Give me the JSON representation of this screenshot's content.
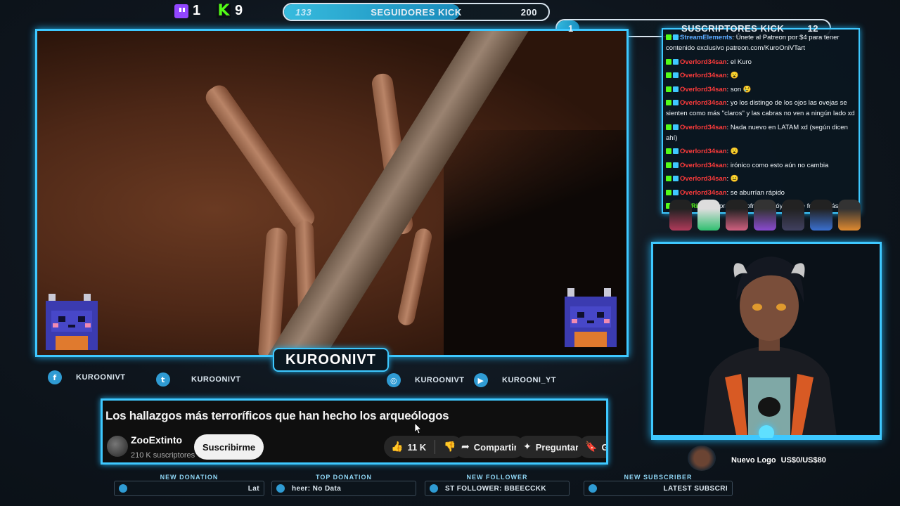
{
  "top_bar": {
    "twitch_count": "1",
    "kick_count": "9",
    "followers_goal": {
      "current": "133",
      "label": "SEGUIDORES KICK",
      "target": "200",
      "progress": 0.665
    },
    "subscribers_goal": {
      "current": "1",
      "label": "SUSCRIPTORES KICK",
      "target": "12",
      "progress": 0.083
    }
  },
  "brand_tag": "KUROONIVT",
  "socials": {
    "facebook": "KUROONIVT",
    "twitter": "KUROONIVT",
    "instagram": "KUROONIVT",
    "youtube": "KUROONI_YT"
  },
  "youtube": {
    "title": "Los hallazgos más terroríficos que han hecho los arqueólogos",
    "channel": "ZooExtinto",
    "subscribers": "210 K suscriptores",
    "subscribe_label": "Suscribirme",
    "likes": "11 K",
    "share_label": "Compartir",
    "ask_label": "Preguntar",
    "save_label": "Gu"
  },
  "alerts": [
    {
      "label": "NEW DONATION",
      "value": "Lat"
    },
    {
      "label": "TOP DONATION",
      "value": "heer: No Data"
    },
    {
      "label": "NEW FOLLOWER",
      "value": "ST FOLLOWER: BBEECCKK"
    },
    {
      "label": "NEW SUBSCRIBER",
      "value": "LATEST SUBSCRI"
    }
  ],
  "chat": [
    {
      "user": "StreamElements",
      "color": "#5aa9ff",
      "text": ": Únete al Patreon por $4 para tener contenido exclusivo patreon.com/KuroOniVTart"
    },
    {
      "user": "Overlord34san",
      "color": "#ff3b3b",
      "text": ": el Kuro"
    },
    {
      "user": "Overlord34san",
      "color": "#ff3b3b",
      "text": ": 😮"
    },
    {
      "user": "Overlord34san",
      "color": "#ff3b3b",
      "text": ": son 😢"
    },
    {
      "user": "Overlord34san",
      "color": "#ff3b3b",
      "text": ": yo los distingo de los ojos las ovejas se sienten como más \"claros\" y las cabras no ven a ningún lado xd"
    },
    {
      "user": "Overlord34san",
      "color": "#ff3b3b",
      "text": ": Nada nuevo en LATAM xd (según dicen ahí)"
    },
    {
      "user": "Overlord34san",
      "color": "#ff3b3b",
      "text": ": 😮"
    },
    {
      "user": "Overlord34san",
      "color": "#ff3b3b",
      "text": ": irónico como esto aún no cambia"
    },
    {
      "user": "Overlord34san",
      "color": "#ff3b3b",
      "text": ": 😐"
    },
    {
      "user": "Overlord34san",
      "color": "#ff3b3b",
      "text": ": se aburrían rápido"
    },
    {
      "user": "BotRix",
      "color": "#53fc18",
      "text": ": Compra mis cofres y apóyame de forma más económica en www.kuromerch"
    }
  ],
  "donation_goal": {
    "label": "Nuevo Logo",
    "amount": "US$0/US$80"
  },
  "colors": {
    "accent": "#3ec8ff",
    "kick": "#53fc18",
    "twitch": "#9146ff"
  }
}
